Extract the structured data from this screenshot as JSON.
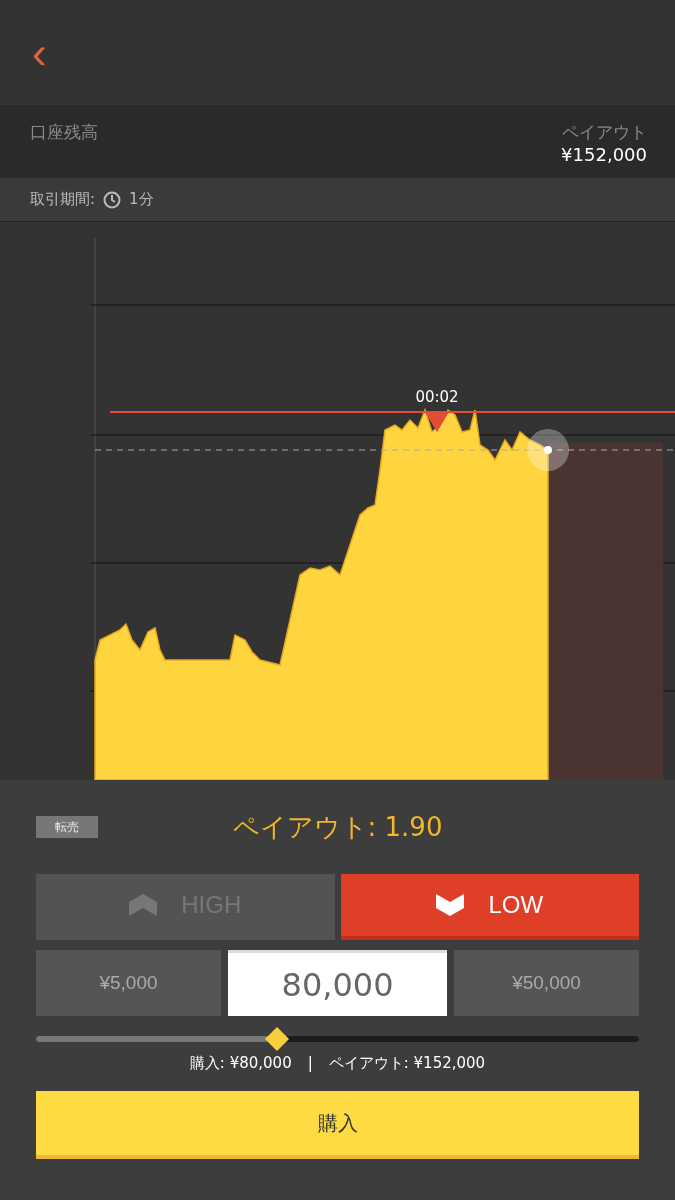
{
  "header": {
    "back": "‹"
  },
  "account": {
    "label": "口座残高",
    "payout_label": "ペイアウト",
    "payout_value": "¥152,000"
  },
  "period": {
    "label": "取引期間:",
    "value": "1分"
  },
  "chart": {
    "marker_time": "00:02"
  },
  "resell": "転売",
  "payout_rate": "ペイアウト: 1.90",
  "directions": [
    {
      "label": "HIGH",
      "kind": "up",
      "selected": false
    },
    {
      "label": "LOW",
      "kind": "down",
      "selected": true
    }
  ],
  "amount": {
    "minus": "¥5,000",
    "value": "80,000",
    "plus": "¥50,000"
  },
  "slider": {
    "level": 0.4
  },
  "summary": {
    "purchase": "購入: ¥80,000",
    "separator": "|",
    "payout": "ペイアウト: ¥152,000"
  },
  "buy_button": "購入"
}
